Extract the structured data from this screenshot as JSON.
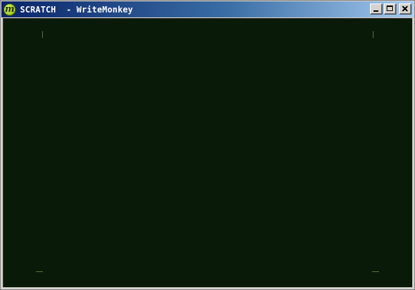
{
  "window": {
    "title": "SCRATCH  - WriteMonkey",
    "app_icon": {
      "name": "writemonkey-logo-icon",
      "glyph": "m",
      "color": "#a7d22a"
    }
  },
  "caption_buttons": [
    "minimize",
    "maximize",
    "close"
  ],
  "editor": {
    "background": "#0a1a08",
    "text": "",
    "corner_marks_color": "#4f7a3a"
  }
}
